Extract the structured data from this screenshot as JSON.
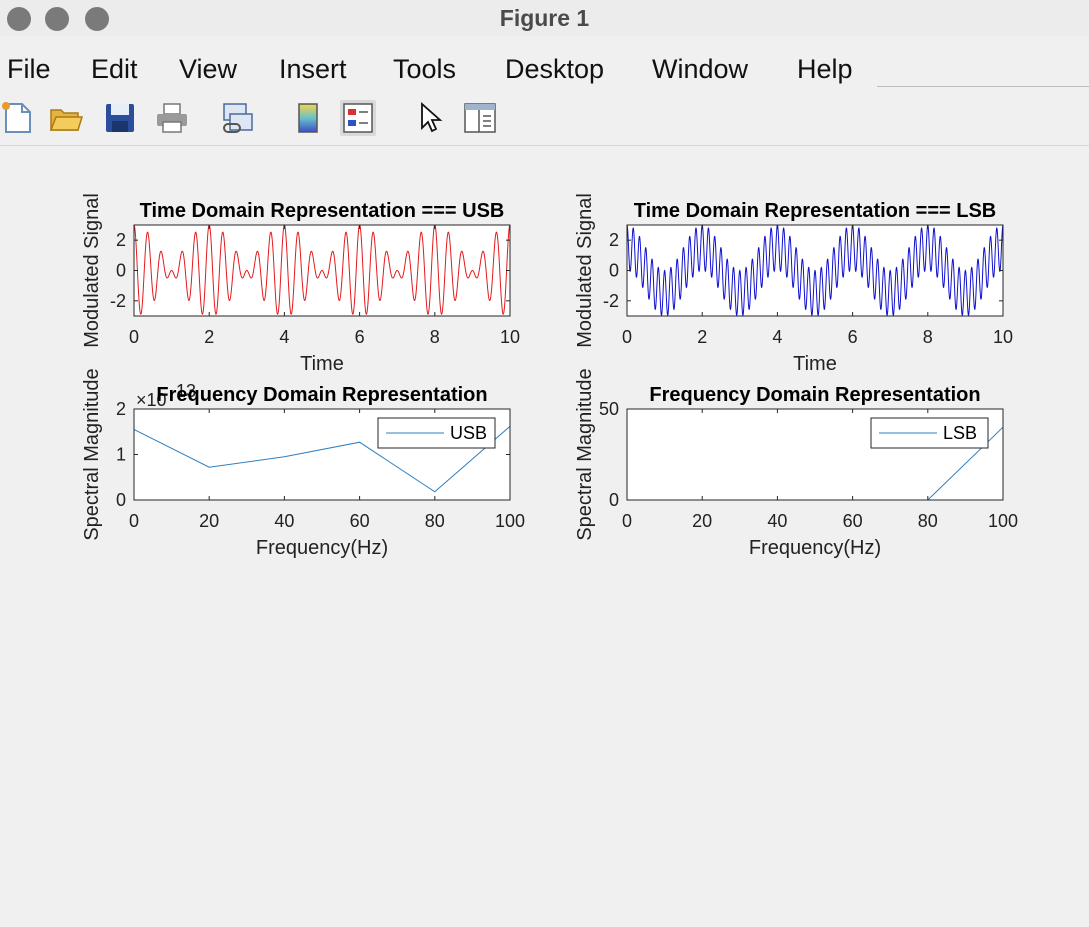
{
  "window": {
    "title": "Figure 1"
  },
  "menu": {
    "items": [
      "File",
      "Edit",
      "View",
      "Insert",
      "Tools",
      "Desktop",
      "Window",
      "Help"
    ]
  },
  "toolbar": {
    "icons": [
      "new-figure-icon",
      "open-file-icon",
      "save-icon",
      "print-icon",
      "link-icon",
      "colorbar-icon",
      "legend-icon",
      "pointer-icon",
      "property-inspector-icon"
    ]
  },
  "colors": {
    "usb": "#e41a1c",
    "lsb": "#1010d0",
    "spectrum": "#2f7fbf"
  },
  "chart_data": [
    {
      "type": "line",
      "title": "Time Domain Representation === USB",
      "xlabel": "Time",
      "ylabel": "Modulated Signal",
      "xlim": [
        0,
        10
      ],
      "ylim": [
        -3,
        3
      ],
      "xticks": [
        0,
        2,
        4,
        6,
        8,
        10
      ],
      "yticks": [
        -2,
        0,
        2
      ],
      "series": [
        {
          "description": "dense oscillating modulated signal, visually periodic; peaks near ±3",
          "x_range": [
            0,
            10
          ],
          "formula": "1.5*cos(2π·3t) + 1.5*cos(2π·2.5t)"
        }
      ]
    },
    {
      "type": "line",
      "title": "Time Domain Representation === LSB",
      "xlabel": "Time",
      "ylabel": "Modulated Signal",
      "xlim": [
        0,
        10
      ],
      "ylim": [
        -3,
        3
      ],
      "xticks": [
        0,
        2,
        4,
        6,
        8,
        10
      ],
      "yticks": [
        -2,
        0,
        2
      ],
      "series": [
        {
          "description": "dense oscillating modulated signal with a slow envelope",
          "x_range": [
            0,
            10
          ],
          "formula": "1.5*cos(2π·0.5t) + 1.5*cos(2π·6t)"
        }
      ]
    },
    {
      "type": "line",
      "title": "Frequency Domain Representation",
      "xlabel": "Frequency(Hz)",
      "ylabel": "Spectral Magnitude",
      "xlim": [
        0,
        100
      ],
      "ylim": [
        0,
        2
      ],
      "xticks": [
        0,
        20,
        40,
        60,
        80,
        100
      ],
      "yticks": [
        0,
        1,
        2
      ],
      "y_exponent_label": "×10",
      "y_exponent": "13",
      "legend_position": "top-right",
      "series": [
        {
          "name": "USB",
          "x": [
            0,
            20,
            40,
            60,
            80,
            100
          ],
          "y": [
            1.55,
            0.72,
            0.95,
            1.27,
            0.18,
            1.62
          ]
        }
      ]
    },
    {
      "type": "line",
      "title": "Frequency Domain Representation",
      "xlabel": "Frequency(Hz)",
      "ylabel": "Spectral Magnitude",
      "xlim": [
        0,
        100
      ],
      "ylim": [
        0,
        50
      ],
      "xticks": [
        0,
        20,
        40,
        60,
        80,
        100
      ],
      "yticks": [
        0,
        50
      ],
      "legend_position": "top-right",
      "series": [
        {
          "name": "LSB",
          "x": [
            0,
            20,
            40,
            60,
            80,
            100
          ],
          "y": [
            0,
            0,
            0,
            0,
            0,
            40
          ]
        }
      ]
    }
  ]
}
